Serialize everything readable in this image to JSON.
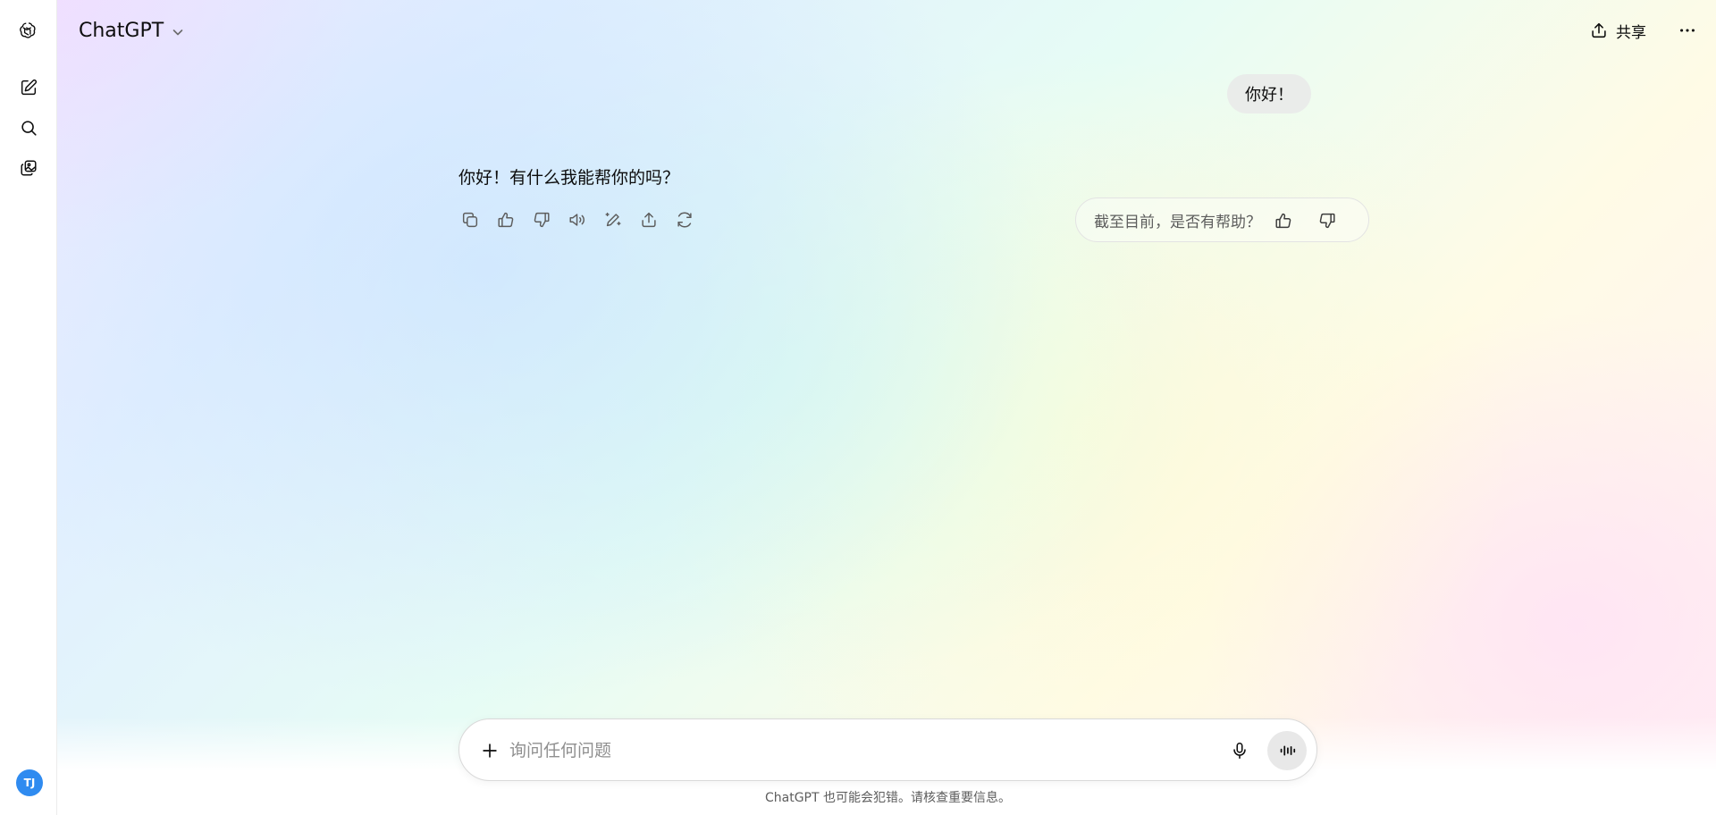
{
  "header": {
    "model_name": "ChatGPT",
    "share_label": "共享"
  },
  "sidebar": {
    "items": [
      {
        "name": "new-chat",
        "icon": "edit-icon"
      },
      {
        "name": "search",
        "icon": "search-icon"
      },
      {
        "name": "library",
        "icon": "images-icon"
      }
    ],
    "avatar_initials": "TJ",
    "avatar_color": "#2f8bf0"
  },
  "conversation": {
    "user_message": "你好！",
    "assistant_message": "你好！有什么我能帮你的吗？",
    "actions": [
      "copy-icon",
      "thumbs-up-icon",
      "thumbs-down-icon",
      "read-aloud-icon",
      "edit-canvas-icon",
      "share-icon",
      "regenerate-icon"
    ]
  },
  "feedback": {
    "prompt": "截至目前，是否有帮助？"
  },
  "composer": {
    "placeholder": "询问任何问题",
    "value": ""
  },
  "footer": {
    "disclaimer": "ChatGPT 也可能会犯错。请核查重要信息。"
  },
  "colors": {
    "text": "#0d0d0d",
    "muted": "#5d5d5d",
    "user_bubble": "#e9e9e9"
  }
}
